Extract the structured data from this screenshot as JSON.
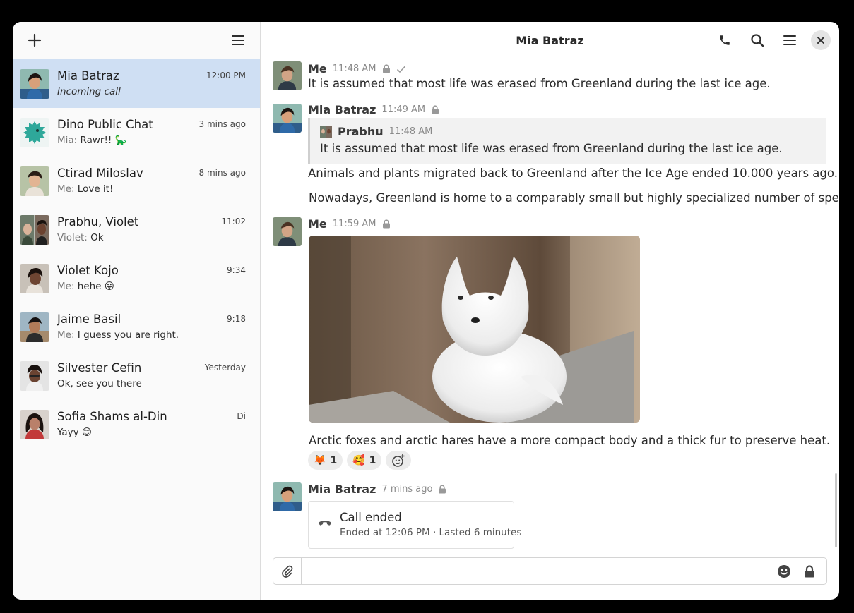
{
  "sidebar": {
    "conversations": [
      {
        "name": "Mia Batraz",
        "prefix": "",
        "preview": "Incoming call",
        "time": "12:00 PM",
        "selected": true
      },
      {
        "name": "Dino Public Chat",
        "prefix": "Mia: ",
        "preview": "Rawr!! 🦕",
        "time": "3 mins ago"
      },
      {
        "name": "Ctirad Miloslav",
        "prefix": "Me: ",
        "preview": "Love it!",
        "time": "8 mins ago"
      },
      {
        "name": "Prabhu, Violet",
        "prefix": "Violet: ",
        "preview": "Ok",
        "time": "11:02"
      },
      {
        "name": "Violet Kojo",
        "prefix": "Me: ",
        "preview": "hehe 😛",
        "time": "9:34"
      },
      {
        "name": "Jaime Basil",
        "prefix": "Me: ",
        "preview": "I guess you are right.",
        "time": "9:18"
      },
      {
        "name": "Silvester Cefin",
        "prefix": "",
        "preview": "Ok, see you there",
        "time": "Yesterday"
      },
      {
        "name": "Sofia Shams al-Din",
        "prefix": "",
        "preview": "Yayy 😊",
        "time": "Di"
      }
    ]
  },
  "chat": {
    "title": "Mia Batraz",
    "messages": {
      "m1": {
        "sender": "Me",
        "time": "11:48 AM",
        "text": "It is assumed that most life was erased from Greenland during the last ice age."
      },
      "m2": {
        "sender": "Mia Batraz",
        "time": "11:49 AM",
        "quote": {
          "sender": "Prabhu",
          "time": "11:48 AM",
          "text": "It is assumed that most life was erased from Greenland during the last ice age."
        },
        "text1": "Animals and plants migrated back to Greenland after the Ice Age ended 10.000 years ago.",
        "text2": "Nowadays, Greenland is home to a comparably small but highly specialized number of species."
      },
      "m3": {
        "sender": "Me",
        "time": "11:59 AM",
        "text": "Arctic foxes and arctic hares have a more compact body and a thick fur to preserve heat.",
        "reactions": [
          {
            "emoji": "🦊",
            "count": "1"
          },
          {
            "emoji": "🥰",
            "count": "1"
          }
        ]
      },
      "m4": {
        "sender": "Mia Batraz",
        "time": "7 mins ago",
        "call_title": "Call ended",
        "call_sub": "Ended at 12:06 PM · Lasted 6 minutes"
      }
    }
  },
  "composer": {
    "value": ""
  },
  "colors": {
    "selected_bg": "#cfdff3",
    "background": "#000000"
  }
}
